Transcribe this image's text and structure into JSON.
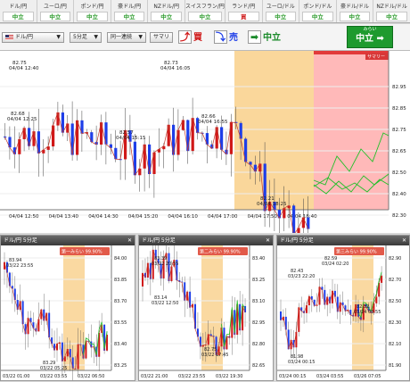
{
  "ticker": [
    {
      "name": "ドル/円",
      "signal": "中立",
      "kind": "neutral"
    },
    {
      "name": "ユーロ/円",
      "signal": "中立",
      "kind": "neutral"
    },
    {
      "name": "ポンド/円",
      "signal": "中立",
      "kind": "neutral"
    },
    {
      "name": "豪ドル/円",
      "signal": "中立",
      "kind": "neutral"
    },
    {
      "name": "NZドル/円",
      "signal": "中立",
      "kind": "neutral"
    },
    {
      "name": "スイスフラン/円",
      "signal": "中立",
      "kind": "neutral"
    },
    {
      "name": "ランド/円",
      "signal": "買",
      "kind": "buy"
    },
    {
      "name": "ユーロ/ドル",
      "signal": "中立",
      "kind": "neutral"
    },
    {
      "name": "ポンド/ドル",
      "signal": "中立",
      "kind": "neutral"
    },
    {
      "name": "豪ドル/ドル",
      "signal": "中立",
      "kind": "neutral"
    },
    {
      "name": "NZドル/ドル",
      "signal": "中立",
      "kind": "neutral"
    }
  ],
  "toolbar": {
    "pair": "ドル/円",
    "timeframe": "5分足",
    "continuity": "同一連続",
    "summary": "サマリ",
    "buy": "買",
    "sell": "売",
    "neutral": "中立",
    "big_sub": "みらい",
    "big_label": "中立"
  },
  "main_chart": {
    "summary_tag": "サマリー",
    "x_labels": [
      "04/04 12:50",
      "04/04 13:40",
      "04/04 14:30",
      "04/04 15:20",
      "04/04 16:10",
      "04/04 17:00",
      "04/04 17:50",
      "04/04 18:40"
    ],
    "y_labels": [
      "82.95",
      "82.85",
      "82.75",
      "82.65",
      "82.50",
      "82.40",
      "82.30",
      "82.20"
    ],
    "annotations": [
      {
        "price": "82.75",
        "time": "04/04 12:40"
      },
      {
        "price": "82.68",
        "time": "04/04 12:25"
      },
      {
        "price": "82.73",
        "time": "04/04 16:05"
      },
      {
        "price": "82.57",
        "time": "04/04 15:15"
      },
      {
        "price": "82.66",
        "time": "04/04 16:55"
      },
      {
        "price": "82.21",
        "time": "04/04 18:25"
      }
    ]
  },
  "minis": [
    {
      "title": "ドル/円 5分足",
      "badge": "第一みらい 99.90%",
      "x_labels": [
        "03/22 01:00",
        "03/22 03:55",
        "03/22 06:50"
      ],
      "y_labels": [
        "84.00",
        "83.85",
        "83.70",
        "83.55",
        "83.40",
        "83.25"
      ],
      "annotations": [
        {
          "price": "83.94",
          "time": "03/22 23:55"
        },
        {
          "price": "83.29",
          "time": "03/22 05:25"
        }
      ]
    },
    {
      "title": "ドル/円 5分足",
      "badge": "第二みらい 99.90%",
      "x_labels": [
        "03/22 21:00",
        "03/22 23:55",
        "03/22 19:30"
      ],
      "y_labels": [
        "83.40",
        "83.25",
        "83.10",
        "82.95",
        "82.80",
        "82.65"
      ],
      "annotations": [
        {
          "price": "83.39",
          "time": "03/22 20:35"
        },
        {
          "price": "83.14",
          "time": "03/22 12:50"
        },
        {
          "price": "82.75",
          "time": "03/22 17:45"
        }
      ]
    },
    {
      "title": "ドル/円 5分足",
      "badge": "第三みらい 99.90%",
      "x_labels": [
        "03/24 00:15",
        "03/24 03:55",
        "03/26 07:05"
      ],
      "y_labels": [
        "82.90",
        "82.70",
        "82.50",
        "82.30",
        "82.10",
        "81.90"
      ],
      "annotations": [
        {
          "price": "82.43",
          "time": "03/23 22:20"
        },
        {
          "price": "82.59",
          "time": "03/24 02:20"
        },
        {
          "price": "82.32",
          "time": "03/24 03:55"
        },
        {
          "price": "81.98",
          "time": "03/24 00:15"
        }
      ]
    }
  ],
  "colors": {
    "up": "#d01818",
    "down": "#1e3ee8",
    "zone": "#f9d08a",
    "forecast": "#ff8080"
  }
}
